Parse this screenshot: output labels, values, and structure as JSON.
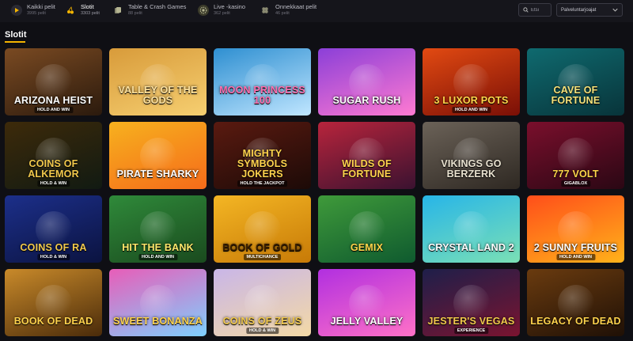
{
  "nav": {
    "categories": [
      {
        "label": "Kaikki pelit",
        "count": "3995 pelit",
        "icon": "play-icon",
        "active": false
      },
      {
        "label": "Slotit",
        "count": "3303 pelit",
        "icon": "cherry-icon",
        "active": true
      },
      {
        "label": "Table & Crash Games",
        "count": "88 pelit",
        "icon": "cards-icon",
        "active": false
      },
      {
        "label": "Live -kasino",
        "count": "362 pelit",
        "icon": "chip-icon",
        "active": false
      },
      {
        "label": "Onnekkaat pelit",
        "count": "46 pelit",
        "icon": "clover-icon",
        "active": false
      }
    ],
    "search_placeholder": "Etsi",
    "provider_label": "Palveluntarjoajat"
  },
  "section": {
    "title": "Slotit"
  },
  "games": [
    {
      "name": "ARIZONA HEIST",
      "sub": "HOLD AND WIN",
      "bg": "#7a4a22",
      "bg2": "#2b1a0d",
      "fg": "#ffffff"
    },
    {
      "name": "VALLEY OF THE GODS",
      "sub": "",
      "bg": "#d89b3a",
      "bg2": "#f6cf71",
      "fg": "#ffe3a0"
    },
    {
      "name": "Moon Princess 100",
      "sub": "",
      "bg": "#2e8fd1",
      "bg2": "#c0e6ff",
      "fg": "#ff6fb0"
    },
    {
      "name": "SUGAR RUSH",
      "sub": "",
      "bg": "#8b3fd8",
      "bg2": "#ff7ad1",
      "fg": "#ffffff"
    },
    {
      "name": "3 LUXOR POTS",
      "sub": "HOLD AND WIN",
      "bg": "#e24a12",
      "bg2": "#7a0f06",
      "fg": "#ffd54a"
    },
    {
      "name": "CAVE OF FORTUNE",
      "sub": "",
      "bg": "#0f6a6f",
      "bg2": "#08343a",
      "fg": "#f6e27a"
    },
    {
      "name": "COINS OF ALKEMOR",
      "sub": "HOLD & WIN",
      "bg": "#3d2a0a",
      "bg2": "#111a12",
      "fg": "#f2c94c"
    },
    {
      "name": "PIRATE SHARKY",
      "sub": "",
      "bg": "#f7b11e",
      "bg2": "#f56b1a",
      "fg": "#ffffff"
    },
    {
      "name": "MIGHTY SYMBOLS JOKERS",
      "sub": "HOLD THE JACKPOT",
      "bg": "#5a1a10",
      "bg2": "#1c0a07",
      "fg": "#ffd34d"
    },
    {
      "name": "WILDS OF FORTUNE",
      "sub": "",
      "bg": "#b8243c",
      "bg2": "#3a1230",
      "fg": "#ffd34d"
    },
    {
      "name": "VIKINGS GO BERZERK",
      "sub": "",
      "bg": "#6b6258",
      "bg2": "#2e2822",
      "fg": "#e9e2d0"
    },
    {
      "name": "777 VOLT",
      "sub": "GIGABLOX",
      "bg": "#7a0f2c",
      "bg2": "#2a0714",
      "fg": "#ffd54a"
    },
    {
      "name": "COINS OF RA",
      "sub": "HOLD & WIN",
      "bg": "#1c2f8a",
      "bg2": "#0b1340",
      "fg": "#f2c94c"
    },
    {
      "name": "HIT THE BANK",
      "sub": "HOLD AND WIN",
      "bg": "#2f8a3a",
      "bg2": "#1a4a1e",
      "fg": "#ffe86b"
    },
    {
      "name": "BOOK OF GOLD",
      "sub": "MULTICHANCE",
      "bg": "#f4b624",
      "bg2": "#c77a07",
      "fg": "#3a1e00"
    },
    {
      "name": "GEMIX",
      "sub": "",
      "bg": "#3f9a3a",
      "bg2": "#0f5a2f",
      "fg": "#ffd54a"
    },
    {
      "name": "CRYSTAL LAND 2",
      "sub": "",
      "bg": "#27b5e8",
      "bg2": "#7be0b5",
      "fg": "#ffffff"
    },
    {
      "name": "2 SUNNY FRUITS",
      "sub": "HOLD AND WIN",
      "bg": "#ff4e1a",
      "bg2": "#ffb21a",
      "fg": "#ffffff"
    },
    {
      "name": "BOOK OF DEAD",
      "sub": "",
      "bg": "#c98a2a",
      "bg2": "#4a2b0a",
      "fg": "#ffd34d"
    },
    {
      "name": "SWEET BONANZA",
      "sub": "",
      "bg": "#e85db8",
      "bg2": "#7fd0ff",
      "fg": "#ffd34d"
    },
    {
      "name": "COINS OF ZEUS",
      "sub": "HOLD & WIN",
      "bg": "#c9b6e8",
      "bg2": "#f3d9a6",
      "fg": "#f2c94c"
    },
    {
      "name": "JELLY VALLEY",
      "sub": "",
      "bg": "#b12fe0",
      "bg2": "#ff71c7",
      "fg": "#ffffff"
    },
    {
      "name": "JESTER'S VEGAS",
      "sub": "EXPERIENCE",
      "bg": "#1e1f4a",
      "bg2": "#7a1430",
      "fg": "#f2c94c"
    },
    {
      "name": "LEGACY OF DEAD",
      "sub": "",
      "bg": "#6a3b0f",
      "bg2": "#1f1006",
      "fg": "#ffd34d"
    }
  ]
}
